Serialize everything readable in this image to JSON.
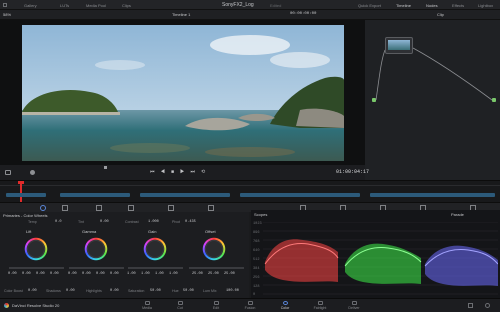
{
  "app": {
    "top_left_labels": [
      "Gallery",
      "LUTs",
      "Media Pool",
      "Clips"
    ],
    "project_title": "SonyFX2_Log",
    "edited_tag": "Edited",
    "top_right_labels": [
      "Quick Export",
      "Timeline",
      "Nodes",
      "Effects",
      "Lightbox"
    ]
  },
  "viewer": {
    "zoom": "58%",
    "timeline_name": "Timeline 1",
    "src_timecode": "00:00:00:00",
    "clip_label": "Clip",
    "rec_timecode": "01:00:04:17"
  },
  "primaries": {
    "title": "Primaries - Color Wheels",
    "params_top": [
      {
        "label": "Temp",
        "value": "0.0"
      },
      {
        "label": "Tint",
        "value": "0.00"
      },
      {
        "label": "Contrast",
        "value": "1.000"
      },
      {
        "label": "Pivot",
        "value": "0.435"
      }
    ],
    "wheels": [
      {
        "label": "Lift",
        "values": [
          "0.00",
          "0.00",
          "0.00",
          "0.00"
        ]
      },
      {
        "label": "Gamma",
        "values": [
          "0.00",
          "0.00",
          "0.00",
          "0.00"
        ]
      },
      {
        "label": "Gain",
        "values": [
          "1.00",
          "1.00",
          "1.00",
          "1.00"
        ]
      },
      {
        "label": "Offset",
        "values": [
          "25.00",
          "25.00",
          "25.00",
          ""
        ]
      }
    ],
    "params_bottom": [
      {
        "label": "Color Boost",
        "value": "0.00"
      },
      {
        "label": "Shadows",
        "value": "0.00"
      },
      {
        "label": "Highlights",
        "value": "0.00"
      },
      {
        "label": "Saturation",
        "value": "50.00"
      },
      {
        "label": "Hue",
        "value": "50.00"
      },
      {
        "label": "Lum Mix",
        "value": "100.00"
      }
    ]
  },
  "scopes": {
    "title": "Scopes",
    "mode": "Parade",
    "y_ticks": [
      "1023",
      "896",
      "768",
      "640",
      "512",
      "384",
      "256",
      "128",
      "0"
    ],
    "colors": {
      "red": "#ff4646",
      "green": "#3ef04a",
      "blue": "#6b6bff"
    }
  },
  "footer": {
    "app_name": "DaVinci Resolve Studio 20",
    "pages": [
      "Media",
      "Cut",
      "Edit",
      "Fusion",
      "Color",
      "Fairlight",
      "Deliver"
    ],
    "active_page": "Color"
  },
  "colors": {
    "accent": "#e02b2b",
    "node_green": "#79c86a",
    "active_blue": "#5a86d8"
  }
}
